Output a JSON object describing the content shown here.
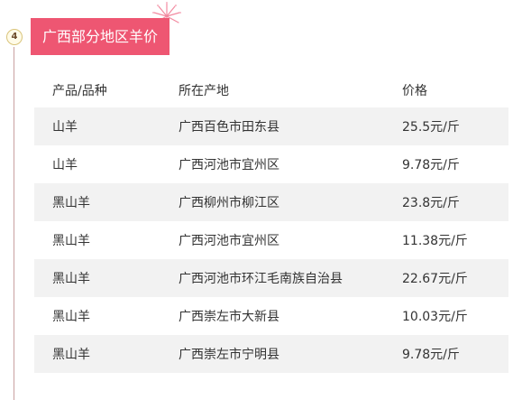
{
  "step": {
    "number": "4"
  },
  "section": {
    "title": "广西部分地区羊价"
  },
  "table": {
    "headers": [
      "产品/品种",
      "所在产地",
      "价格"
    ],
    "rows": [
      [
        "山羊",
        "广西百色市田东县",
        "25.5元/斤"
      ],
      [
        "山羊",
        "广西河池市宜州区",
        "9.78元/斤"
      ],
      [
        "黑山羊",
        "广西柳州市柳江区",
        "23.8元/斤"
      ],
      [
        "黑山羊",
        "广西河池市宜州区",
        "11.38元/斤"
      ],
      [
        "黑山羊",
        "广西河池市环江毛南族自治县",
        "22.67元/斤"
      ],
      [
        "黑山羊",
        "广西崇左市大新县",
        "10.03元/斤"
      ],
      [
        "黑山羊",
        "广西崇左市宁明县",
        "9.78元/斤"
      ]
    ]
  },
  "colors": {
    "accent": "#ee5672",
    "badge_border": "#d9c47a",
    "row_stripe": "#f2f2f2"
  }
}
